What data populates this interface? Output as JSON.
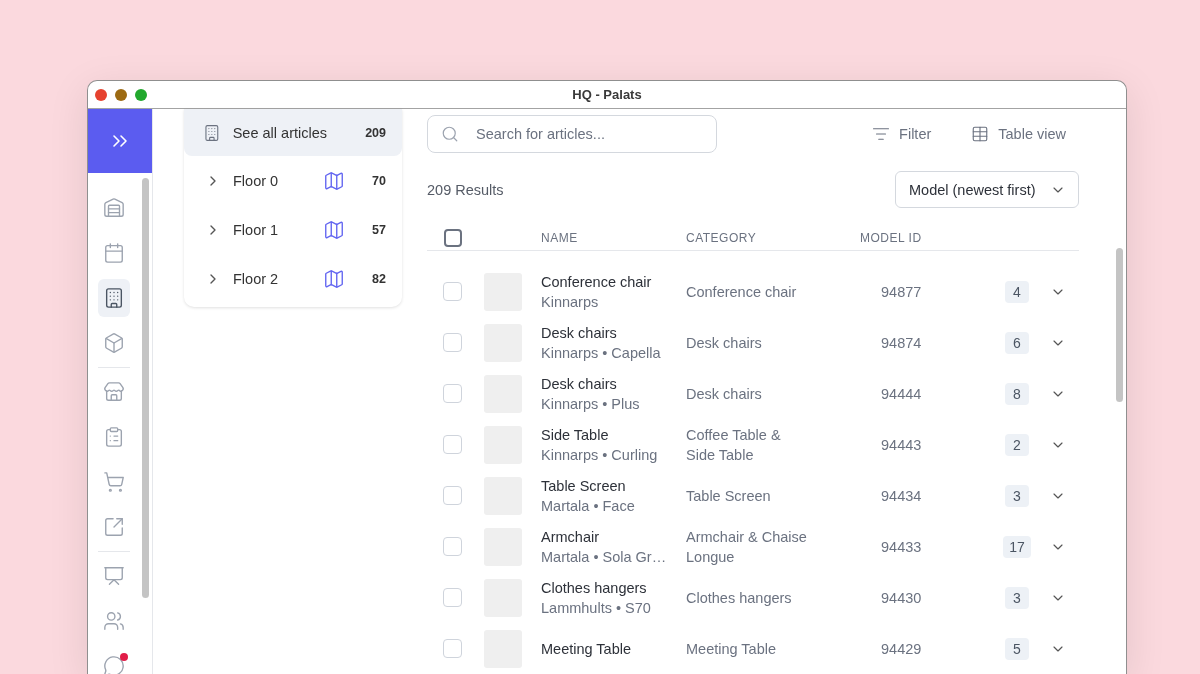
{
  "window": {
    "title": "HQ - Palats"
  },
  "rail": {
    "groups": [
      [
        {
          "selected": false,
          "alert": false
        },
        {
          "selected": false,
          "alert": false
        },
        {
          "selected": true,
          "alert": false
        },
        {
          "selected": false,
          "alert": false
        }
      ],
      [
        {
          "selected": false,
          "alert": false
        },
        {
          "selected": false,
          "alert": false
        },
        {
          "selected": false,
          "alert": false
        },
        {
          "selected": false,
          "alert": false
        }
      ],
      [
        {
          "selected": false,
          "alert": false
        },
        {
          "selected": false,
          "alert": false
        },
        {
          "selected": false,
          "alert": true
        }
      ]
    ]
  },
  "locations": {
    "all_articles": {
      "label": "See all articles",
      "count": "209",
      "selected": true
    },
    "floors": [
      {
        "label": "Floor 0",
        "count": "70",
        "selected": false,
        "expanded": false
      },
      {
        "label": "Floor 1",
        "count": "57",
        "selected": false,
        "expanded": false
      },
      {
        "label": "Floor 2",
        "count": "82",
        "selected": false,
        "expanded": false
      }
    ]
  },
  "search": {
    "placeholder": "Search for articles..."
  },
  "toolbar": [
    {
      "kind": "filter",
      "label": "Filter"
    },
    {
      "kind": "view",
      "label": "Table view"
    }
  ],
  "results": "209 Results",
  "sort": {
    "value": "Model (newest first)"
  },
  "table": {
    "select_all": {
      "checked": false
    },
    "columns": [
      "NAME",
      "CATEGORY",
      "MODEL ID"
    ],
    "rows": [
      {
        "name": "Conference chair",
        "subtitle": "Kinnarps",
        "category": "Conference chair",
        "model_id": "94877",
        "count": "4",
        "checked": false,
        "expanded": false
      },
      {
        "name": "Desk chairs",
        "subtitle": "Kinnarps • Capella",
        "category": "Desk chairs",
        "model_id": "94874",
        "count": "6",
        "checked": false,
        "expanded": false
      },
      {
        "name": "Desk chairs",
        "subtitle": "Kinnarps • Plus",
        "category": "Desk chairs",
        "model_id": "94444",
        "count": "8",
        "checked": false,
        "expanded": false
      },
      {
        "name": "Side Table",
        "subtitle": "Kinnarps • Curling",
        "category": "Coffee Table & Side Table",
        "model_id": "94443",
        "count": "2",
        "checked": false,
        "expanded": false
      },
      {
        "name": "Table Screen",
        "subtitle": "Martala • Face",
        "category": "Table Screen",
        "model_id": "94434",
        "count": "3",
        "checked": false,
        "expanded": false
      },
      {
        "name": "Armchair",
        "subtitle": "Martala • Sola Gr…",
        "category": "Armchair & Chaise Longue",
        "model_id": "94433",
        "count": "17",
        "checked": false,
        "expanded": false
      },
      {
        "name": "Clothes hangers",
        "subtitle": "Lammhults • S70",
        "category": "Clothes hangers",
        "model_id": "94430",
        "count": "3",
        "checked": false,
        "expanded": false
      },
      {
        "name": "Meeting Table",
        "category": "Meeting Table",
        "model_id": "94429",
        "count": "5",
        "checked": false,
        "expanded": false
      }
    ]
  }
}
